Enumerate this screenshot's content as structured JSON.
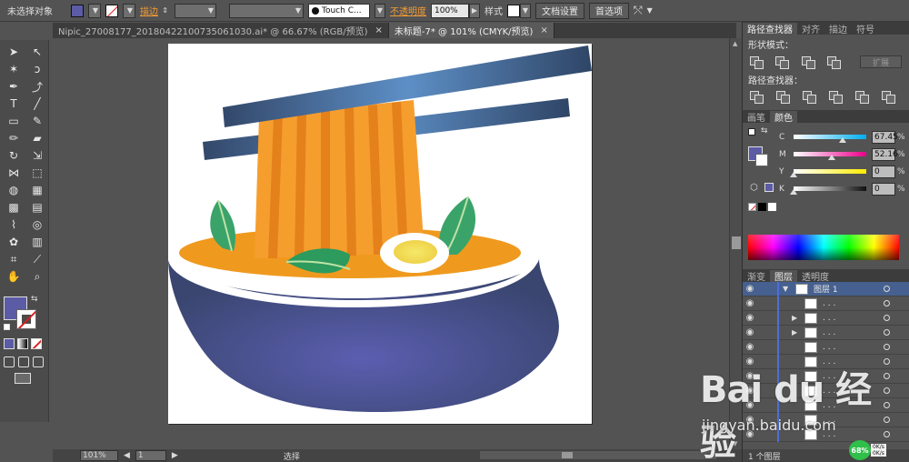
{
  "control_bar": {
    "selection_label": "未选择对象",
    "stroke_label": "描边",
    "brush_name": "Touch C...",
    "opacity_label": "不透明度",
    "opacity_value": "100%",
    "style_label": "样式",
    "doc_setup_label": "文档设置",
    "preferences_label": "首选项"
  },
  "tabs": [
    {
      "label": "Nipic_27008177_20180422100735061030.ai* @ 66.67% (RGB/预览)",
      "active": false
    },
    {
      "label": "未标题-7* @ 101% (CMYK/预览)",
      "active": true
    }
  ],
  "pathfinder": {
    "tabs": [
      "路径查找器",
      "对齐",
      "描边",
      "符号"
    ],
    "shape_modes_label": "形状模式：",
    "expand_label": "扩展",
    "pathfinders_label": "路径查找器："
  },
  "color_panel": {
    "tabs": [
      "画笔",
      "颜色"
    ],
    "channels": [
      {
        "label": "C",
        "value": "67.45",
        "fraction": 0.67,
        "gradient": "linear-gradient(to right,#fff,#00aeef)"
      },
      {
        "label": "M",
        "value": "52.16",
        "fraction": 0.52,
        "gradient": "linear-gradient(to right,#fff,#ec008c)"
      },
      {
        "label": "Y",
        "value": "0",
        "fraction": 0.0,
        "gradient": "linear-gradient(to right,#fff,#ffec00)"
      },
      {
        "label": "K",
        "value": "0",
        "fraction": 0.0,
        "gradient": "linear-gradient(to right,#fff,#111)"
      }
    ],
    "percent": "%"
  },
  "layers_panel": {
    "tabs": [
      "渐变",
      "图层",
      "透明度"
    ],
    "layer_name": "图层 1",
    "sublayer_label": ". . .",
    "footer": "1 个图层"
  },
  "status_bar": {
    "zoom": "101%",
    "page": "1",
    "mode": "选择"
  },
  "watermark": {
    "brand": "Bai du 经验",
    "url": "jingyan.baidu.com"
  },
  "badge": {
    "percent": "68%",
    "speed_up": "0K/s",
    "speed_down": "0K/s"
  },
  "colors": {
    "fill": "#5b5ba6",
    "accent_orange": "#f39c36",
    "bowl": "#4e5b95",
    "noodle": "#f59e2e",
    "chopsticks": "#3b5a7e"
  }
}
